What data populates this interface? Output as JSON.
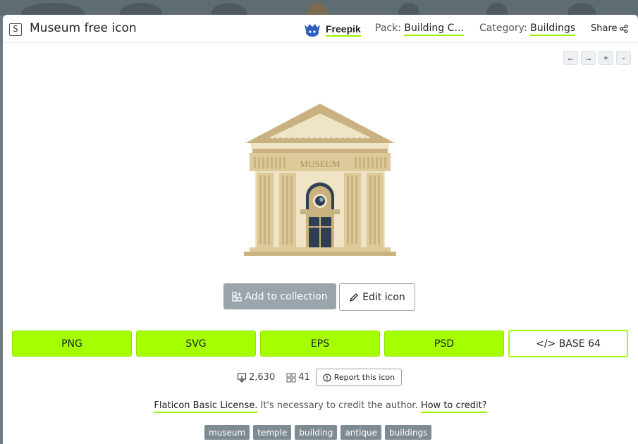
{
  "header": {
    "title": "Museum free icon",
    "author": "Freepik",
    "pack_label": "Pack:",
    "pack_value": "Building C…",
    "category_label": "Category:",
    "category_value": "Buildings",
    "share_label": "Share"
  },
  "zoom": {
    "prev": "←",
    "next": "→",
    "zoom_in": "+",
    "zoom_out": "-"
  },
  "preview": {
    "sign_text": "MUSEUM"
  },
  "actions": {
    "add_collection": "Add to collection",
    "edit_icon": "Edit icon"
  },
  "formats": [
    {
      "label": "PNG"
    },
    {
      "label": "SVG"
    },
    {
      "label": "EPS"
    },
    {
      "label": "PSD"
    },
    {
      "label": "</> BASE 64"
    }
  ],
  "stats": {
    "downloads": "2,630",
    "collections": "41",
    "report": "Report this icon"
  },
  "license": {
    "name": "Flaticon Basic License.",
    "text": " It's necessary to credit the author. ",
    "how": "How to credit?"
  },
  "tags": [
    "museum",
    "temple",
    "building",
    "antique",
    "buildings"
  ],
  "colors": {
    "accent": "#a5ff00",
    "building_main": "#c9b27f",
    "building_light": "#efe4c6",
    "window": "#2e3f52"
  }
}
